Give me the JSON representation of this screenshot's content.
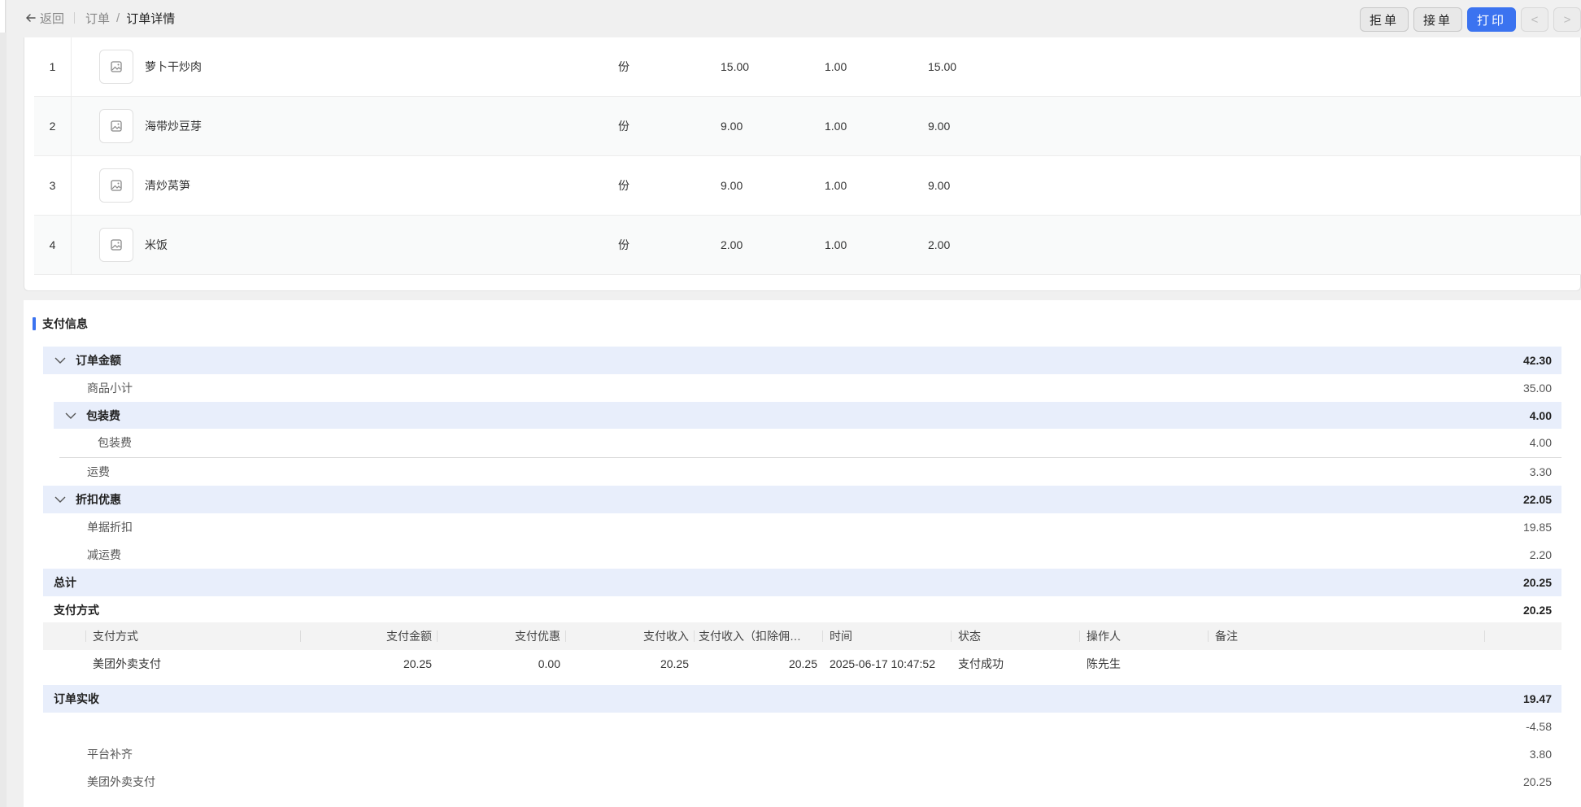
{
  "header": {
    "back_label": "返回",
    "breadcrumb": [
      "订单",
      "订单详情"
    ],
    "breadcrumb_sep": "/",
    "actions": [
      "拒单",
      "接单",
      "打印"
    ],
    "prev_label": "<",
    "next_label": ">",
    "accent_color": "#3b73f0"
  },
  "items": [
    {
      "index": "1",
      "name": "萝卜干炒肉",
      "unit": "份",
      "price": "15.00",
      "qty": "1.00",
      "amount": "15.00"
    },
    {
      "index": "2",
      "name": "海带炒豆芽",
      "unit": "份",
      "price": "9.00",
      "qty": "1.00",
      "amount": "9.00"
    },
    {
      "index": "3",
      "name": "清炒莴笋",
      "unit": "份",
      "price": "9.00",
      "qty": "1.00",
      "amount": "9.00"
    },
    {
      "index": "4",
      "name": "米饭",
      "unit": "份",
      "price": "2.00",
      "qty": "1.00",
      "amount": "2.00"
    }
  ],
  "payment": {
    "section_title": "支付信息",
    "order_amount": {
      "label": "订单金额",
      "value": "42.30"
    },
    "goods_subtotal": {
      "label": "商品小计",
      "value": "35.00"
    },
    "packing_group": {
      "label": "包装费",
      "value": "4.00"
    },
    "packing_item": {
      "label": "包装费",
      "value": "4.00"
    },
    "shipping": {
      "label": "运费",
      "value": "3.30"
    },
    "discount_group": {
      "label": "折扣优惠",
      "value": "22.05"
    },
    "doc_discount": {
      "label": "单据折扣",
      "value": "19.85"
    },
    "shipping_reduction": {
      "label": "减运费",
      "value": "2.20"
    },
    "total": {
      "label": "总计",
      "value": "20.25"
    },
    "pay_method": {
      "label": "支付方式",
      "value": "20.25"
    },
    "table": {
      "headers": [
        "支付方式",
        "支付金额",
        "支付优惠",
        "支付收入",
        "支付收入（扣除佣…",
        "时间",
        "状态",
        "操作人",
        "备注"
      ],
      "rows": [
        {
          "method": "美团外卖支付",
          "amount": "20.25",
          "discount": "0.00",
          "income": "20.25",
          "net_income": "20.25",
          "time": "2025-06-17 10:47:52",
          "status": "支付成功",
          "operator": "陈先生",
          "remark": ""
        }
      ]
    },
    "actual_received": {
      "label": "订单实收",
      "value": "19.47"
    },
    "unnamed_line": {
      "label": "",
      "value": "-4.58"
    },
    "platform_subsidy": {
      "label": "平台补齐",
      "value": "3.80"
    },
    "meituan_pay": {
      "label": "美团外卖支付",
      "value": "20.25"
    }
  }
}
